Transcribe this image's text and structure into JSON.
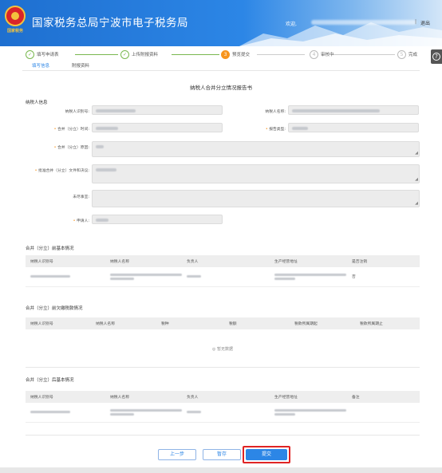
{
  "header": {
    "emblem_text": "国家税务",
    "title": "国家税务总局宁波市电子税务局",
    "welcome": "欢迎,",
    "separator": "|",
    "logout": "退出"
  },
  "side_button_icon": "help-icon",
  "steps": [
    {
      "num": "✓",
      "label": "填写申请表",
      "state": "done"
    },
    {
      "num": "✓",
      "label": "上传附报资料",
      "state": "done"
    },
    {
      "num": "3",
      "label": "预览提交",
      "state": "active"
    },
    {
      "num": "4",
      "label": "审核中",
      "state": "todo"
    },
    {
      "num": "5",
      "label": "完成",
      "state": "todo"
    }
  ],
  "tabs": [
    {
      "label": "填写信息",
      "active": true
    },
    {
      "label": "附报资料",
      "active": false
    }
  ],
  "doc_title": "纳税人合并分立情况报告书",
  "taxpayer_section": "纳税人信息",
  "fields": {
    "taxpayer_id": "纳税人识别号:",
    "taxpayer_name": "纳税人名称:",
    "merge_time": "合并（分立）时间:",
    "report_type": "报告类型:",
    "merge_reason": "合并（分立）原因:",
    "approval_doc": "批准合并（分立）文件和决议:",
    "pending": "未尽事宜:",
    "applicant": "申请人:"
  },
  "table1": {
    "title": "合并（分立）前基本情况",
    "headers": [
      "纳税人识别号",
      "纳税人名称",
      "负责人",
      "生产经营地址",
      "是否注销"
    ],
    "rows": [
      {
        "cancelled": "否"
      }
    ]
  },
  "table2": {
    "title": "合并（分立）前欠缴税款情况",
    "headers": [
      "纳税人识别号",
      "纳税人名称",
      "税种",
      "税额",
      "税款所属期起",
      "税款所属期止"
    ],
    "empty": "◎ 暂无数据"
  },
  "table3": {
    "title": "合并（分立）后基本情况",
    "headers": [
      "纳税人识别号",
      "纳税人名称",
      "负责人",
      "生产经营地址",
      "备注"
    ]
  },
  "buttons": {
    "prev": "上一步",
    "save": "暂存",
    "submit": "提交"
  },
  "colors": {
    "header_blue": "#2c86e6",
    "step_done": "#79b84f",
    "step_active": "#f7941d",
    "highlight": "#e02424"
  }
}
